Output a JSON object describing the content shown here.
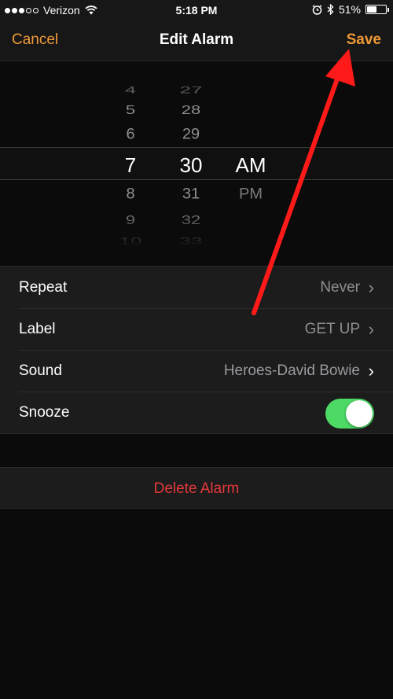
{
  "status_bar": {
    "carrier": "Verizon",
    "time": "5:18 PM",
    "battery": "51%",
    "battery_level": 0.51,
    "icons": [
      "signal-dots-icon",
      "wifi-icon",
      "alarm-clock-icon",
      "bluetooth-icon",
      "battery-icon"
    ]
  },
  "nav": {
    "cancel": "Cancel",
    "title": "Edit Alarm",
    "save": "Save",
    "accent_color": "#f09a37"
  },
  "picker": {
    "hours": [
      "4",
      "5",
      "6",
      "7",
      "8",
      "9",
      "10"
    ],
    "minutes": [
      "27",
      "28",
      "29",
      "30",
      "31",
      "32",
      "33"
    ],
    "periods": [
      "AM",
      "PM"
    ],
    "selected_hour": "7",
    "selected_minute": "30",
    "selected_period": "AM"
  },
  "settings": {
    "repeat": {
      "label": "Repeat",
      "value": "Never"
    },
    "label": {
      "label": "Label",
      "value": "GET UP"
    },
    "sound": {
      "label": "Sound",
      "value": "Heroes-David Bowie"
    },
    "snooze": {
      "label": "Snooze",
      "on": true,
      "toggle_color": "#4cd964"
    }
  },
  "delete": {
    "label": "Delete Alarm",
    "color": "#e5393b"
  },
  "annotation": {
    "type": "red-arrow",
    "points_to": "Save",
    "color": "#ff1a1a"
  }
}
